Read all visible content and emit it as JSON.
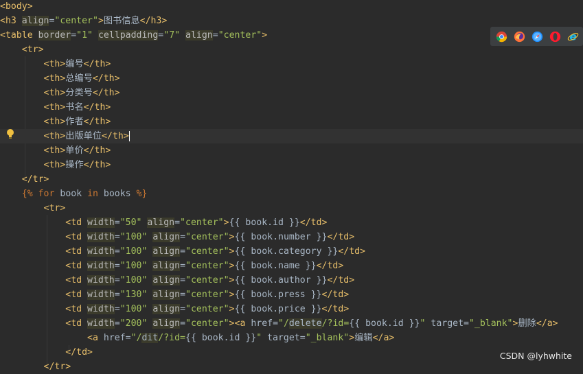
{
  "browser_icons": [
    "chrome-icon",
    "firefox-icon",
    "safari-icon",
    "opera-icon",
    "ie-icon"
  ],
  "watermark": "CSDN @lyhwhite",
  "lines": [
    [
      [
        "tag",
        "<body>"
      ]
    ],
    [
      [
        "tag",
        "<h3 "
      ],
      [
        "attr",
        "align"
      ],
      [
        "txt",
        "="
      ],
      [
        "str",
        "\"center\""
      ],
      [
        "tag",
        ">"
      ],
      [
        "txt",
        "图书信息"
      ],
      [
        "tag",
        "</h3>"
      ]
    ],
    [
      [
        "tag",
        "<table "
      ],
      [
        "attr",
        "border"
      ],
      [
        "txt",
        "="
      ],
      [
        "str",
        "\"1\""
      ],
      [
        "txt",
        " "
      ],
      [
        "attr",
        "cellpadding"
      ],
      [
        "txt",
        "="
      ],
      [
        "str",
        "\"7\""
      ],
      [
        "txt",
        " "
      ],
      [
        "attr",
        "align"
      ],
      [
        "txt",
        "="
      ],
      [
        "str",
        "\"center\""
      ],
      [
        "tag",
        ">"
      ]
    ],
    [
      [
        "txt",
        "    "
      ],
      [
        "tag",
        "<tr>"
      ]
    ],
    [
      [
        "txt",
        "        "
      ],
      [
        "tag",
        "<th>"
      ],
      [
        "txt",
        "编号"
      ],
      [
        "tag",
        "</th>"
      ]
    ],
    [
      [
        "txt",
        "        "
      ],
      [
        "tag",
        "<th>"
      ],
      [
        "txt",
        "总编号"
      ],
      [
        "tag",
        "</th>"
      ]
    ],
    [
      [
        "txt",
        "        "
      ],
      [
        "tag",
        "<th>"
      ],
      [
        "txt",
        "分类号"
      ],
      [
        "tag",
        "</th>"
      ]
    ],
    [
      [
        "txt",
        "        "
      ],
      [
        "tag",
        "<th>"
      ],
      [
        "txt",
        "书名"
      ],
      [
        "tag",
        "</th>"
      ]
    ],
    [
      [
        "txt",
        "        "
      ],
      [
        "tag",
        "<th>"
      ],
      [
        "txt",
        "作者"
      ],
      [
        "tag",
        "</th>"
      ]
    ],
    [
      [
        "txt",
        "        "
      ],
      [
        "tag",
        "<th>"
      ],
      [
        "txt",
        "出版单位"
      ],
      [
        "tag",
        "</th>"
      ]
    ],
    [
      [
        "txt",
        "        "
      ],
      [
        "tag",
        "<th>"
      ],
      [
        "txt",
        "单价"
      ],
      [
        "tag",
        "</th>"
      ]
    ],
    [
      [
        "txt",
        "        "
      ],
      [
        "tag",
        "<th>"
      ],
      [
        "txt",
        "操作"
      ],
      [
        "tag",
        "</th>"
      ]
    ],
    [
      [
        "txt",
        "    "
      ],
      [
        "tag",
        "</tr>"
      ]
    ],
    [
      [
        "txt",
        "    "
      ],
      [
        "tpl",
        "{%"
      ],
      [
        "txt",
        " "
      ],
      [
        "tpl",
        "for"
      ],
      [
        "txt",
        " book "
      ],
      [
        "tpl",
        "in"
      ],
      [
        "txt",
        " books "
      ],
      [
        "tpl",
        "%}"
      ]
    ],
    [
      [
        "txt",
        "        "
      ],
      [
        "tag",
        "<tr>"
      ]
    ],
    [
      [
        "txt",
        "            "
      ],
      [
        "tag",
        "<td "
      ],
      [
        "attr",
        "width"
      ],
      [
        "txt",
        "="
      ],
      [
        "str",
        "\"50\""
      ],
      [
        "txt",
        " "
      ],
      [
        "attr",
        "align"
      ],
      [
        "txt",
        "="
      ],
      [
        "str",
        "\"center\""
      ],
      [
        "tag",
        ">"
      ],
      [
        "txt",
        "{{ book.id }}"
      ],
      [
        "tag",
        "</td>"
      ]
    ],
    [
      [
        "txt",
        "            "
      ],
      [
        "tag",
        "<td "
      ],
      [
        "attr",
        "width"
      ],
      [
        "txt",
        "="
      ],
      [
        "str",
        "\"100\""
      ],
      [
        "txt",
        " "
      ],
      [
        "attr",
        "align"
      ],
      [
        "txt",
        "="
      ],
      [
        "str",
        "\"center\""
      ],
      [
        "tag",
        ">"
      ],
      [
        "txt",
        "{{ book.number }}"
      ],
      [
        "tag",
        "</td>"
      ]
    ],
    [
      [
        "txt",
        "            "
      ],
      [
        "tag",
        "<td "
      ],
      [
        "attr",
        "width"
      ],
      [
        "txt",
        "="
      ],
      [
        "str",
        "\"100\""
      ],
      [
        "txt",
        " "
      ],
      [
        "attr",
        "align"
      ],
      [
        "txt",
        "="
      ],
      [
        "str",
        "\"center\""
      ],
      [
        "tag",
        ">"
      ],
      [
        "txt",
        "{{ book.category }}"
      ],
      [
        "tag",
        "</td>"
      ]
    ],
    [
      [
        "txt",
        "            "
      ],
      [
        "tag",
        "<td "
      ],
      [
        "attr",
        "width"
      ],
      [
        "txt",
        "="
      ],
      [
        "str",
        "\"100\""
      ],
      [
        "txt",
        " "
      ],
      [
        "attr",
        "align"
      ],
      [
        "txt",
        "="
      ],
      [
        "str",
        "\"center\""
      ],
      [
        "tag",
        ">"
      ],
      [
        "txt",
        "{{ book.name }}"
      ],
      [
        "tag",
        "</td>"
      ]
    ],
    [
      [
        "txt",
        "            "
      ],
      [
        "tag",
        "<td "
      ],
      [
        "attr",
        "width"
      ],
      [
        "txt",
        "="
      ],
      [
        "str",
        "\"100\""
      ],
      [
        "txt",
        " "
      ],
      [
        "attr",
        "align"
      ],
      [
        "txt",
        "="
      ],
      [
        "str",
        "\"center\""
      ],
      [
        "tag",
        ">"
      ],
      [
        "txt",
        "{{ book.author }}"
      ],
      [
        "tag",
        "</td>"
      ]
    ],
    [
      [
        "txt",
        "            "
      ],
      [
        "tag",
        "<td "
      ],
      [
        "attr",
        "width"
      ],
      [
        "txt",
        "="
      ],
      [
        "str",
        "\"130\""
      ],
      [
        "txt",
        " "
      ],
      [
        "attr",
        "align"
      ],
      [
        "txt",
        "="
      ],
      [
        "str",
        "\"center\""
      ],
      [
        "tag",
        ">"
      ],
      [
        "txt",
        "{{ book.press }}"
      ],
      [
        "tag",
        "</td>"
      ]
    ],
    [
      [
        "txt",
        "            "
      ],
      [
        "tag",
        "<td "
      ],
      [
        "attr",
        "width"
      ],
      [
        "txt",
        "="
      ],
      [
        "str",
        "\"100\""
      ],
      [
        "txt",
        " "
      ],
      [
        "attr",
        "align"
      ],
      [
        "txt",
        "="
      ],
      [
        "str",
        "\"center\""
      ],
      [
        "tag",
        ">"
      ],
      [
        "txt",
        "{{ book.price }}"
      ],
      [
        "tag",
        "</td>"
      ]
    ],
    [
      [
        "txt",
        "            "
      ],
      [
        "tag",
        "<td "
      ],
      [
        "attr",
        "width"
      ],
      [
        "txt",
        "="
      ],
      [
        "str",
        "\"200\""
      ],
      [
        "txt",
        " "
      ],
      [
        "attr",
        "align"
      ],
      [
        "txt",
        "="
      ],
      [
        "str",
        "\"center\""
      ],
      [
        "tag",
        ">"
      ],
      [
        "tag",
        "<a "
      ],
      [
        "txt",
        "href="
      ],
      [
        "str",
        "\"/"
      ],
      [
        "hl",
        "delete"
      ],
      [
        "str",
        "/?id="
      ],
      [
        "txt",
        "{{ book.id }}"
      ],
      [
        "str",
        "\""
      ],
      [
        "txt",
        " target="
      ],
      [
        "str",
        "\"_blank\""
      ],
      [
        "tag",
        ">"
      ],
      [
        "txt",
        "删除"
      ],
      [
        "tag",
        "</a>"
      ]
    ],
    [
      [
        "txt",
        "                "
      ],
      [
        "tag",
        "<a "
      ],
      [
        "txt",
        "href="
      ],
      [
        "str",
        "\"/"
      ],
      [
        "hl",
        "dit"
      ],
      [
        "str",
        "/?id="
      ],
      [
        "txt",
        "{{ book.id }}"
      ],
      [
        "str",
        "\""
      ],
      [
        "txt",
        " target="
      ],
      [
        "str",
        "\"_blank\""
      ],
      [
        "tag",
        ">"
      ],
      [
        "txt",
        "编辑"
      ],
      [
        "tag",
        "</a>"
      ]
    ],
    [
      [
        "txt",
        "            "
      ],
      [
        "tag",
        "</td>"
      ]
    ],
    [
      [
        "txt",
        "        "
      ],
      [
        "tag",
        "</tr>"
      ]
    ]
  ]
}
